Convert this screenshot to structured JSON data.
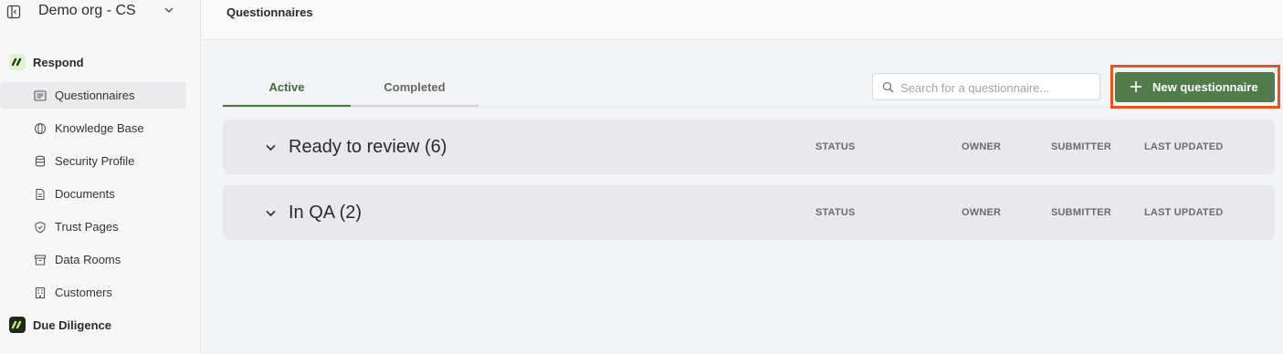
{
  "org": {
    "name": "Demo org - CS"
  },
  "sidebar": {
    "sections": [
      {
        "label": "Respond"
      },
      {
        "label": "Due Diligence"
      }
    ],
    "items": [
      {
        "label": "Questionnaires",
        "icon": "list-icon"
      },
      {
        "label": "Knowledge Base",
        "icon": "globe-icon"
      },
      {
        "label": "Security Profile",
        "icon": "database-icon"
      },
      {
        "label": "Documents",
        "icon": "document-icon"
      },
      {
        "label": "Trust Pages",
        "icon": "shield-icon"
      },
      {
        "label": "Data Rooms",
        "icon": "archive-icon"
      },
      {
        "label": "Customers",
        "icon": "building-icon"
      }
    ]
  },
  "header": {
    "title": "Questionnaires"
  },
  "tabs": [
    {
      "label": "Active"
    },
    {
      "label": "Completed"
    }
  ],
  "search": {
    "placeholder": "Search for a questionnaire..."
  },
  "toolbar": {
    "new_label": "New questionnaire"
  },
  "groups": [
    {
      "title": "Ready to review (6)",
      "columns": [
        "STATUS",
        "OWNER",
        "SUBMITTER",
        "LAST UPDATED"
      ]
    },
    {
      "title": "In QA (2)",
      "columns": [
        "STATUS",
        "OWNER",
        "SUBMITTER",
        "LAST UPDATED"
      ]
    }
  ],
  "colors": {
    "accent": "#527b4c",
    "highlight": "#e8541e",
    "logo": "#b9e89a"
  }
}
